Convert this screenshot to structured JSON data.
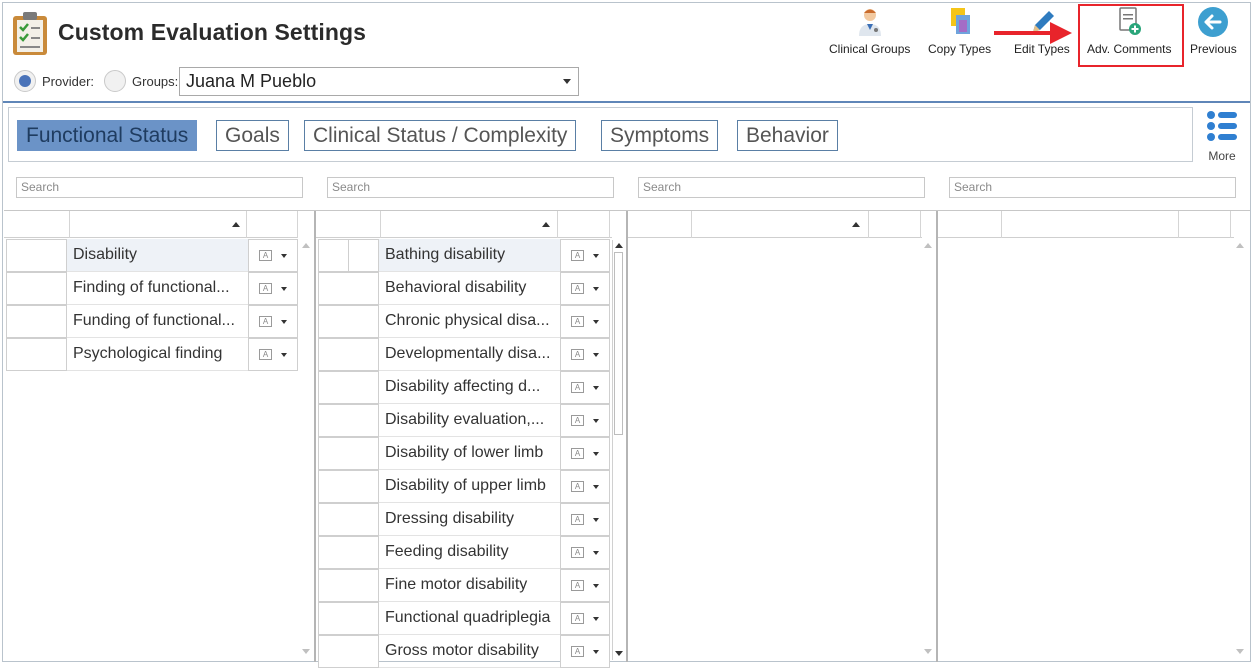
{
  "header": {
    "title": "Custom Evaluation Settings",
    "provider_label": "Provider:",
    "groups_label": "Groups:",
    "selected_provider": "Juana M Pueblo"
  },
  "toolbar": {
    "clinical_groups": "Clinical Groups",
    "copy_types": "Copy Types",
    "edit_types": "Edit Types",
    "adv_comments": "Adv. Comments",
    "previous": "Previous"
  },
  "tabs": [
    "Functional Status",
    "Goals",
    "Clinical Status / Complexity",
    "Symptoms",
    "Behavior"
  ],
  "more_label": "More",
  "search_placeholder": "Search",
  "colors": {
    "accent": "#6b93c7",
    "highlight": "#e8242b",
    "header_line": "#5f86b8"
  },
  "column1_items": [
    "Disability",
    "Finding of functional...",
    "Funding of functional...",
    "Psychological finding"
  ],
  "column2_items": [
    "Bathing disability",
    "Behavioral disability",
    "Chronic physical disa...",
    "Developmentally disa...",
    "Disability  affecting d...",
    "Disability evaluation,...",
    "Disability of lower limb",
    "Disability of upper limb",
    "Dressing disability",
    "Feeding disability",
    "Fine motor disability",
    "Functional quadriplegia",
    "Gross motor disability"
  ],
  "action_icon_text": "A"
}
